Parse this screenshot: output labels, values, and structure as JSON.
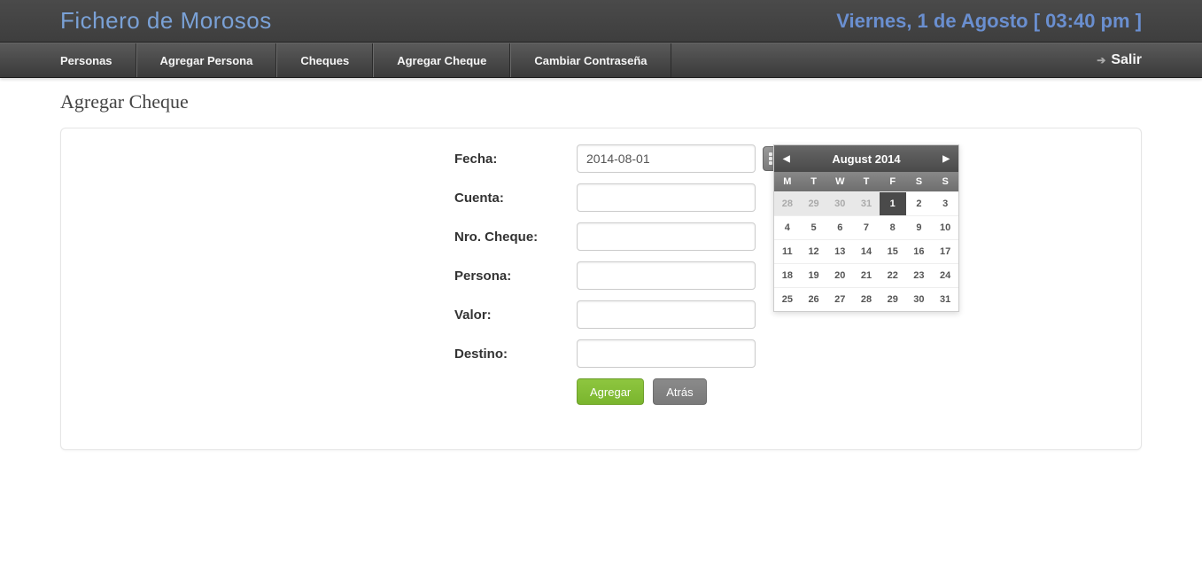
{
  "header": {
    "title": "Fichero de Morosos",
    "date": "Viernes, 1 de Agosto [ 03:40 pm ]"
  },
  "nav": {
    "items": [
      "Personas",
      "Agregar Persona",
      "Cheques",
      "Agregar Cheque",
      "Cambiar Contraseña"
    ],
    "exit": "Salir"
  },
  "page_title": "Agregar Cheque",
  "form": {
    "fecha_label": "Fecha:",
    "fecha_value": "2014-08-01",
    "cuenta_label": "Cuenta:",
    "cuenta_value": "",
    "nro_cheque_label": "Nro. Cheque:",
    "nro_cheque_value": "",
    "persona_label": "Persona:",
    "persona_value": "",
    "valor_label": "Valor:",
    "valor_value": "",
    "destino_label": "Destino:",
    "destino_value": "",
    "agregar": "Agregar",
    "atras": "Atrás"
  },
  "calendar": {
    "title": "August 2014",
    "dow": [
      "M",
      "T",
      "W",
      "T",
      "F",
      "S",
      "S"
    ],
    "cells": [
      {
        "d": "28",
        "o": true
      },
      {
        "d": "29",
        "o": true
      },
      {
        "d": "30",
        "o": true
      },
      {
        "d": "31",
        "o": true
      },
      {
        "d": "1",
        "t": true
      },
      {
        "d": "2"
      },
      {
        "d": "3"
      },
      {
        "d": "4"
      },
      {
        "d": "5"
      },
      {
        "d": "6"
      },
      {
        "d": "7"
      },
      {
        "d": "8"
      },
      {
        "d": "9"
      },
      {
        "d": "10"
      },
      {
        "d": "11"
      },
      {
        "d": "12"
      },
      {
        "d": "13"
      },
      {
        "d": "14"
      },
      {
        "d": "15"
      },
      {
        "d": "16"
      },
      {
        "d": "17"
      },
      {
        "d": "18"
      },
      {
        "d": "19"
      },
      {
        "d": "20"
      },
      {
        "d": "21"
      },
      {
        "d": "22"
      },
      {
        "d": "23"
      },
      {
        "d": "24"
      },
      {
        "d": "25"
      },
      {
        "d": "26"
      },
      {
        "d": "27"
      },
      {
        "d": "28"
      },
      {
        "d": "29"
      },
      {
        "d": "30"
      },
      {
        "d": "31"
      }
    ]
  }
}
